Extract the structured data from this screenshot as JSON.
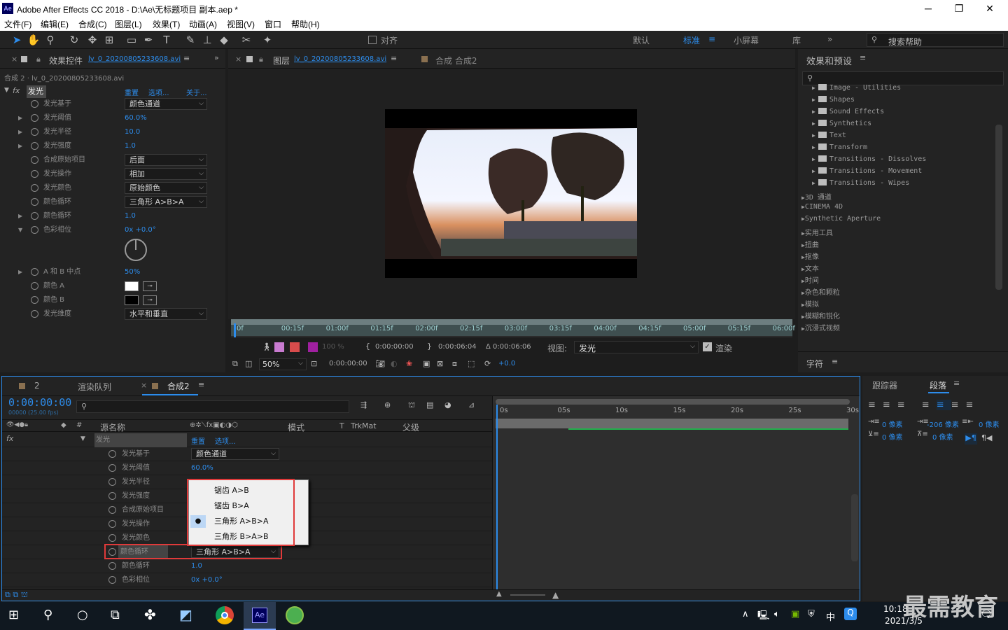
{
  "window": {
    "title": "Adobe After Effects CC 2018 - D:\\Ae\\无标题项目 副本.aep *",
    "logo": "Ae"
  },
  "menu": [
    "文件(F)",
    "编辑(E)",
    "合成(C)",
    "图层(L)",
    "效果(T)",
    "动画(A)",
    "视图(V)",
    "窗口",
    "帮助(H)"
  ],
  "toolbar": {
    "snap_label": "对齐",
    "workspaces": [
      "默认",
      "标准",
      "小屏幕",
      "库"
    ],
    "active_workspace": "标准",
    "search_help": "搜索帮助"
  },
  "effect_controls": {
    "tab_label": "效果控件",
    "layer_name": "lv_0_20200805233608.avi",
    "breadcrumb": "合成 2 · lv_0_20200805233608.avi",
    "effect_name": "发光",
    "links": [
      "重置",
      "选项...",
      "关于..."
    ],
    "props": [
      {
        "name": "发光基于",
        "type": "dropdown",
        "value": "颜色通道"
      },
      {
        "name": "发光阈值",
        "type": "value",
        "value": "60.0%",
        "expand": true
      },
      {
        "name": "发光半径",
        "type": "value",
        "value": "10.0",
        "expand": true
      },
      {
        "name": "发光强度",
        "type": "value",
        "value": "1.0",
        "expand": true
      },
      {
        "name": "合成原始项目",
        "type": "dropdown",
        "value": "后面"
      },
      {
        "name": "发光操作",
        "type": "dropdown",
        "value": "相加"
      },
      {
        "name": "发光颜色",
        "type": "dropdown",
        "value": "原始颜色"
      },
      {
        "name": "颜色循环",
        "type": "dropdown",
        "value": "三角形 A>B>A"
      },
      {
        "name": "颜色循环",
        "type": "value",
        "value": "1.0",
        "expand": true
      },
      {
        "name": "色彩相位",
        "type": "value",
        "value": "0x +0.0°",
        "expand": true
      }
    ],
    "props2": [
      {
        "name": "A 和 B 中点",
        "type": "value",
        "value": "50%",
        "expand": true
      },
      {
        "name": "颜色 A",
        "type": "color",
        "value": "#ffffff"
      },
      {
        "name": "颜色 B",
        "type": "color",
        "value": "#000000"
      },
      {
        "name": "发光维度",
        "type": "dropdown",
        "value": "水平和垂直"
      }
    ]
  },
  "viewer": {
    "tab_label": "图层",
    "layer_name": "lv_0_20200805233608.avi",
    "comp_tab": "合成 合成2",
    "ruler_ticks": [
      "0f",
      "00:15f",
      "01:00f",
      "01:15f",
      "02:00f",
      "02:15f",
      "03:00f",
      "03:15f",
      "04:00f",
      "04:15f",
      "05:00f",
      "05:15f",
      "06:00f"
    ],
    "opacity": "100 %",
    "in_time": "0:00:00:00",
    "out_time": "0:00:06:04",
    "duration": "Δ 0:00:06:06",
    "view_label": "视图:",
    "view_value": "发光",
    "render_label": "渲染",
    "zoom": "50%",
    "current_time": "0:00:00:00",
    "exposure": "+0.0"
  },
  "effects_presets": {
    "title": "效果和预设",
    "folders": [
      "Image - Utilities",
      "Shapes",
      "Sound Effects",
      "Synthetics",
      "Text",
      "Transform",
      "Transitions - Dissolves",
      "Transitions - Movement",
      "Transitions - Wipes"
    ],
    "categories": [
      "3D 通道",
      "CINEMA 4D",
      "Synthetic Aperture",
      "实用工具",
      "扭曲",
      "抠像",
      "文本",
      "时间",
      "杂色和颗粒",
      "模拟",
      "模糊和锐化",
      "沉浸式视频"
    ]
  },
  "character_panel": {
    "title": "字符"
  },
  "timeline": {
    "tabs": [
      "2",
      "渲染队列",
      "合成2"
    ],
    "timecode": "0:00:00:00",
    "fps": "00000 (25.00 fps)",
    "columns": [
      "源名称",
      "模式",
      "T",
      "TrkMat",
      "父级"
    ],
    "effect_name": "发光",
    "links": [
      "重置",
      "选项..."
    ],
    "props": [
      {
        "name": "发光基于",
        "type": "dropdown",
        "value": "颜色通道"
      },
      {
        "name": "发光阈值",
        "type": "value",
        "value": "60.0%"
      },
      {
        "name": "发光半径",
        "type": "value",
        "value": ""
      },
      {
        "name": "发光强度",
        "type": "value",
        "value": ""
      },
      {
        "name": "合成原始项目",
        "type": "value",
        "value": ""
      },
      {
        "name": "发光操作",
        "type": "value",
        "value": ""
      },
      {
        "name": "发光颜色",
        "type": "value",
        "value": ""
      },
      {
        "name": "颜色循环",
        "type": "dropdown",
        "value": "三角形 A>B>A"
      },
      {
        "name": "颜色循环",
        "type": "value",
        "value": "1.0"
      },
      {
        "name": "色彩相位",
        "type": "value",
        "value": "0x +0.0°"
      }
    ],
    "ruler": [
      "0s",
      "05s",
      "10s",
      "15s",
      "20s",
      "25s",
      "30s"
    ],
    "popup_options": [
      "锯齿 A>B",
      "锯齿 B>A",
      "三角形 A>B>A",
      "三角形 B>A>B"
    ],
    "popup_selected": 2
  },
  "tracker_panel": {
    "tabs": [
      "跟踪器",
      "段落"
    ],
    "active": "段落",
    "indent_values": [
      "0 像素",
      "-206 像素",
      "0 像素",
      "0 像素",
      "0 像素"
    ]
  },
  "taskbar": {
    "time": "10:18",
    "date": "2021/3/5",
    "ime": "中",
    "watermark": "最需教育"
  }
}
